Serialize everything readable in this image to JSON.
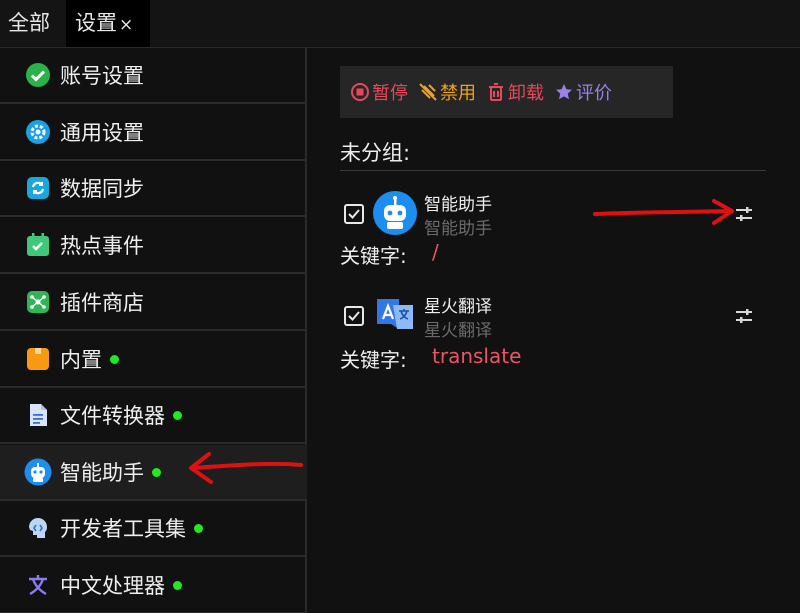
{
  "tabs": {
    "all": "全部",
    "settings": "设置",
    "close": "×"
  },
  "sidebar": {
    "items": [
      {
        "label": "账号设置",
        "dot": false
      },
      {
        "label": "通用设置",
        "dot": false
      },
      {
        "label": "数据同步",
        "dot": false
      },
      {
        "label": "热点事件",
        "dot": false
      },
      {
        "label": "插件商店",
        "dot": false
      },
      {
        "label": "内置",
        "dot": true
      },
      {
        "label": "文件转换器",
        "dot": true
      },
      {
        "label": "智能助手",
        "dot": true,
        "active": true
      },
      {
        "label": "开发者工具集",
        "dot": true
      },
      {
        "label": "中文处理器",
        "dot": true
      }
    ]
  },
  "toolbar": {
    "pause": "暂停",
    "disable": "禁用",
    "uninstall": "卸载",
    "rate": "评价"
  },
  "group": {
    "title": "未分组:"
  },
  "plugins": [
    {
      "name": "智能助手",
      "subtitle": "智能助手",
      "keyword_label": "关键字:",
      "keyword": "/"
    },
    {
      "name": "星火翻译",
      "subtitle": "星火翻译",
      "keyword_label": "关键字:",
      "keyword": "translate"
    }
  ],
  "colors": {
    "accent_red": "#e5485b",
    "status_green": "#22e822",
    "annotation_arrow": "#dd1111"
  }
}
